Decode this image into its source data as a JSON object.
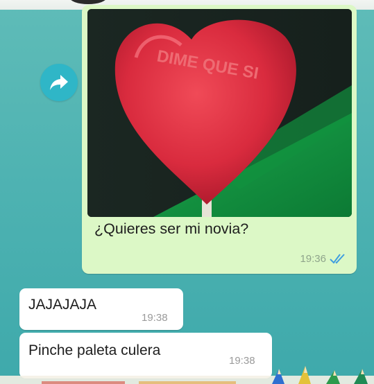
{
  "outgoing": {
    "photo_text": "DIME QUE SI",
    "caption": "¿Quieres ser mi novia?",
    "time": "19:36",
    "status_icon": "double-check-icon"
  },
  "forward": {
    "icon": "forward-arrow-icon"
  },
  "incoming": [
    {
      "text": "JAJAJAJA",
      "time": "19:38"
    },
    {
      "text": "Pinche paleta culera",
      "time": "19:38"
    }
  ],
  "colors": {
    "wallpaper": "#4fb3b2",
    "outgoing_bubble": "#dcf8c6",
    "incoming_bubble": "#ffffff",
    "read_ticks": "#3f9ee0",
    "forward_button": "#2fb6c7"
  }
}
